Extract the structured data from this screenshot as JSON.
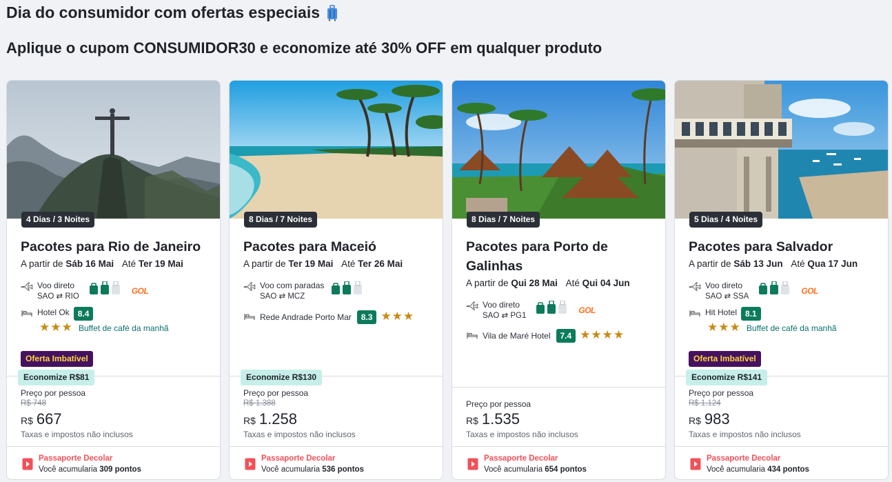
{
  "header": {
    "headline": "Dia do consumidor com ofertas especiais",
    "subline": "Aplique o cupom CONSUMIDOR30 e economize até 30% OFF em qualquer produto"
  },
  "labels": {
    "from": "A partir de",
    "until": "Até",
    "per_person": "Preço por pessoa",
    "currency": "R$",
    "taxes": "Taxas e impostos não inclusos",
    "passport_title": "Passaporte Decolar",
    "passport_prefix": "Você acumularia"
  },
  "colors": {
    "score": "#0c7b5b",
    "deal_bg": "#45125f",
    "deal_text": "#ffd63f",
    "economize_bg": "#c7efe9",
    "stars": "#c88a14",
    "passport": "#f25058",
    "bag_green": "#0c7b5b"
  },
  "cards": [
    {
      "duration": "4 Dias / 3 Noites",
      "title": "Pacotes para Rio de Janeiro",
      "start": "Sáb 16 Mai",
      "end": "Ter 19 Mai",
      "flight_type": "Voo direto",
      "origin": "SAO",
      "destination": "RIO",
      "route_arrow": "⇄",
      "airline": "GOL",
      "hotel": "Hotel Ok",
      "score": "8.4",
      "stars": "★★★",
      "amenity": "Buffet de café da manhã",
      "deal": "Oferta Imbatível",
      "economize": "Economize R$81",
      "old_price": "R$ 748",
      "price": "667",
      "points": "309 pontos",
      "icon": "airplane-icon"
    },
    {
      "duration": "8 Dias / 7 Noites",
      "title": "Pacotes para Maceió",
      "start": "Ter 19 Mai",
      "end": "Ter 26 Mai",
      "flight_type": "Voo com paradas",
      "origin": "SAO",
      "destination": "MCZ",
      "route_arrow": "⇄",
      "airline": "",
      "hotel": "Rede Andrade Porto Mar",
      "score": "8.3",
      "stars": "★★★",
      "amenity": "",
      "deal": "",
      "economize": "Economize R$130",
      "old_price": "R$ 1.388",
      "price": "1.258",
      "points": "536 pontos"
    },
    {
      "duration": "8 Dias / 7 Noites",
      "title": "Pacotes para Porto de Galinhas",
      "start": "Qui 28 Mai",
      "end": "Qui 04 Jun",
      "flight_type": "Voo direto",
      "origin": "SAO",
      "destination": "PG1",
      "route_arrow": "⇄",
      "airline": "GOL",
      "hotel": "Vila de Maré Hotel",
      "score": "7.4",
      "stars": "★★★★",
      "amenity": "",
      "deal": "",
      "economize": "",
      "old_price": "",
      "price": "1.535",
      "points": "654 pontos"
    },
    {
      "duration": "5 Dias / 4 Noites",
      "title": "Pacotes para Salvador",
      "start": "Sáb 13 Jun",
      "end": "Qua 17 Jun",
      "flight_type": "Voo direto",
      "origin": "SAO",
      "destination": "SSA",
      "route_arrow": "⇄",
      "airline": "GOL",
      "hotel": "Hit Hotel",
      "score": "8.1",
      "stars": "★★★",
      "amenity": "Buffet de café da manhã",
      "deal": "Oferta Imbatível",
      "economize": "Economize R$141",
      "old_price": "R$ 1.124",
      "price": "983",
      "points": "434 pontos"
    }
  ]
}
